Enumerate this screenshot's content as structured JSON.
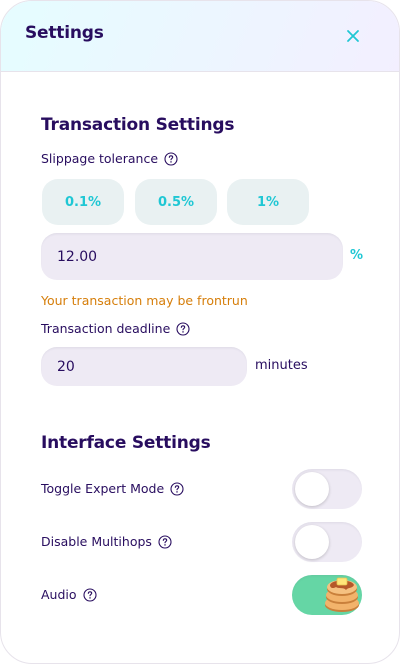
{
  "header": {
    "title": "Settings",
    "close_icon": "close-icon"
  },
  "transaction": {
    "section_title": "Transaction Settings",
    "slippage_label": "Slippage tolerance",
    "slippage_options": [
      "0.1%",
      "0.5%",
      "1%"
    ],
    "slippage_value": "12.00",
    "slippage_unit": "%",
    "warning": "Your transaction may be frontrun",
    "deadline_label": "Transaction deadline",
    "deadline_value": "20",
    "deadline_unit": "minutes"
  },
  "interface": {
    "section_title": "Interface Settings",
    "toggles": [
      {
        "label": "Toggle Expert Mode",
        "on": false
      },
      {
        "label": "Disable Multihops",
        "on": false
      },
      {
        "label": "Audio",
        "on": true
      }
    ]
  },
  "colors": {
    "primary_text": "#280d5f",
    "accent": "#1fc7d4",
    "warning": "#d67e0a",
    "toggle_on": "#65d6a5",
    "input_bg": "#eeeaf4"
  }
}
